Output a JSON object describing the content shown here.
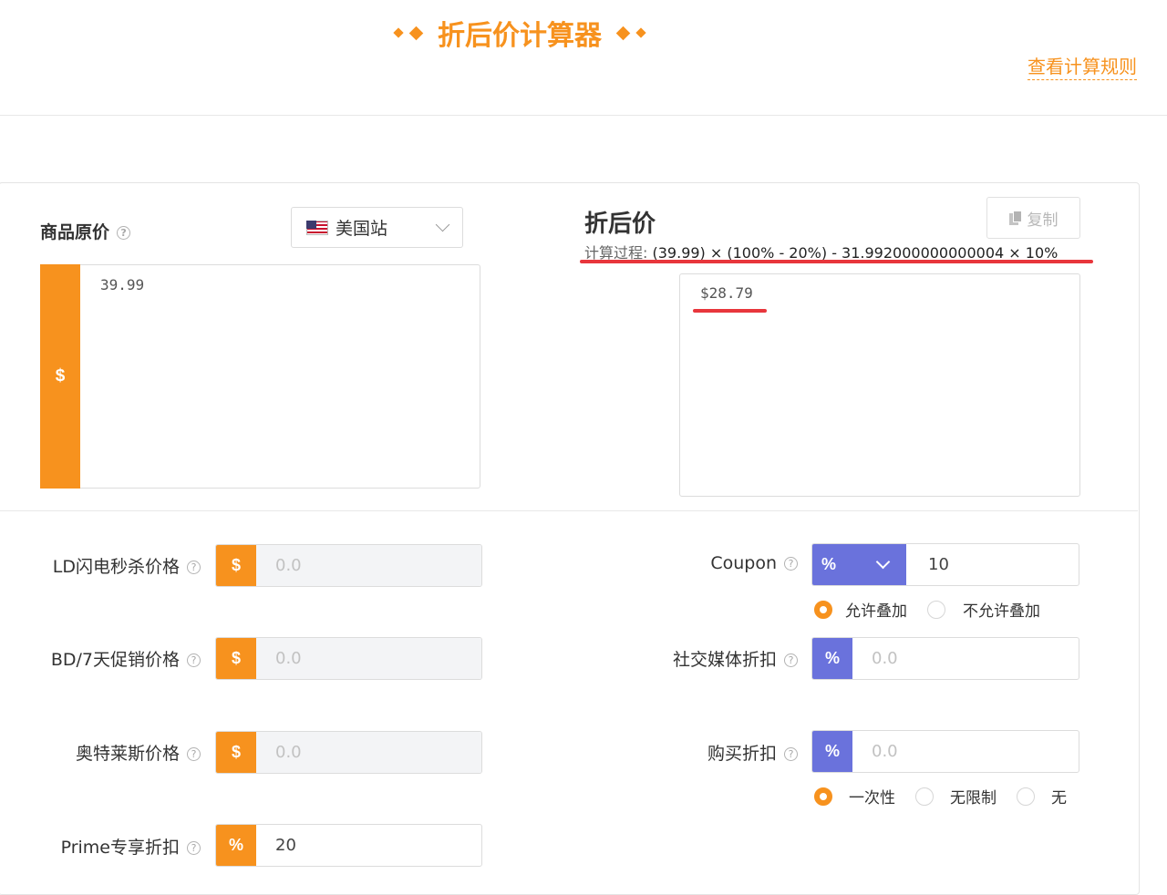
{
  "header": {
    "title": "折后价计算器",
    "rules_link": "查看计算规则"
  },
  "original_price": {
    "label": "商品原价",
    "help": "?",
    "marketplace": "美国站",
    "currency_symbol": "$",
    "value": "39.99"
  },
  "result": {
    "title": "折后价",
    "copy_label": "复制",
    "process_label": "计算过程:",
    "process_formula": "(39.99) × (100% - 20%) - 31.992000000000004 × 10%",
    "value": "$28.79"
  },
  "left_fields": [
    {
      "label": "LD闪电秒杀价格",
      "prefix": "$",
      "placeholder": "0.0"
    },
    {
      "label": "BD/7天促销价格",
      "prefix": "$",
      "placeholder": "0.0"
    },
    {
      "label": "奥特莱斯价格",
      "prefix": "$",
      "placeholder": "0.0"
    },
    {
      "label": "Prime专享折扣",
      "prefix": "%",
      "value": "20"
    }
  ],
  "coupon": {
    "label": "Coupon",
    "type": "%",
    "value": "10",
    "stack_options": [
      "允许叠加",
      "不允许叠加"
    ],
    "stack_selected": "允许叠加"
  },
  "social_discount": {
    "label": "社交媒体折扣",
    "prefix": "%",
    "placeholder": "0.0"
  },
  "purchase_discount": {
    "label": "购买折扣",
    "prefix": "%",
    "placeholder": "0.0",
    "options": [
      "一次性",
      "无限制",
      "无"
    ],
    "selected": "一次性"
  },
  "colors": {
    "accent": "#f7921e",
    "blue": "#6a72dc",
    "highlight_red": "#e8363c"
  },
  "icons": {
    "help": "help-circle-icon",
    "flag": "us-flag-icon",
    "dropdown": "chevron-down-icon",
    "copy": "copy-icon"
  }
}
